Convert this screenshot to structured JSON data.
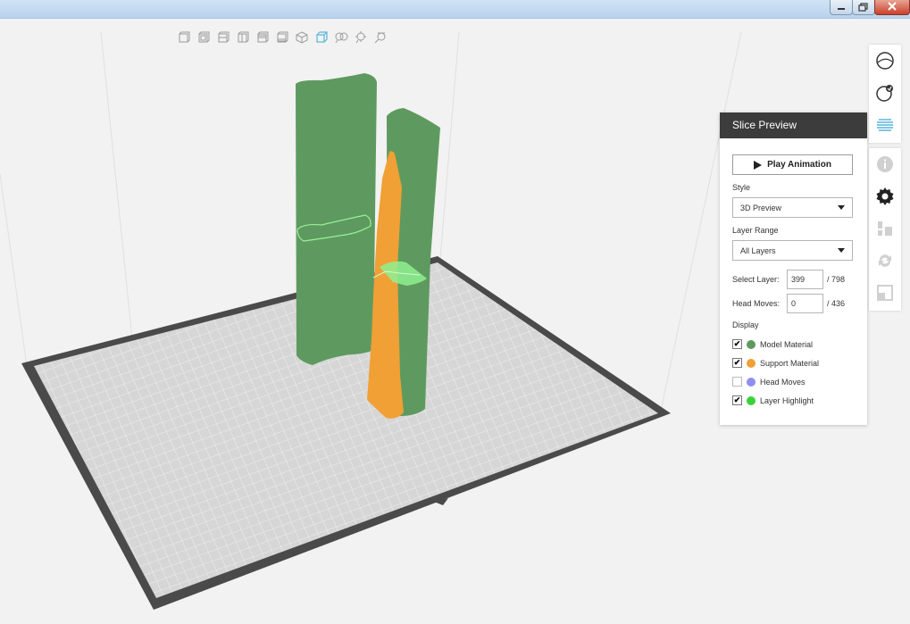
{
  "window": {
    "controls": [
      {
        "name": "minimize-button",
        "icon": "minimize-icon"
      },
      {
        "name": "restore-button",
        "icon": "restore-icon"
      },
      {
        "name": "close-button",
        "icon": "close-icon"
      }
    ]
  },
  "view_toolbar": {
    "icons": [
      "view-front-icon",
      "view-back-icon",
      "view-left-icon",
      "view-right-icon",
      "view-top-icon",
      "view-bottom-icon",
      "view-iso-icon",
      "view-perspective-icon",
      "zoom-icon",
      "zoom-fit-icon",
      "zoom-selection-icon"
    ],
    "active_index": 7
  },
  "right_toolbar": {
    "top_icons": [
      "print-prepare-icon",
      "print-preview-icon",
      "slice-preview-icon"
    ],
    "bottom_icons": [
      "info-icon",
      "settings-gear-icon",
      "align-icon",
      "rotate-icon",
      "scale-icon"
    ]
  },
  "slice_preview": {
    "title": "Slice Preview",
    "play_label": "Play Animation",
    "style_label": "Style",
    "style_value": "3D Preview",
    "layer_range_label": "Layer Range",
    "layer_range_value": "All Layers",
    "select_layer_label": "Select Layer:",
    "select_layer_value": "399",
    "select_layer_total": "/ 798",
    "head_moves_label": "Head Moves:",
    "head_moves_value": "0",
    "head_moves_total": "/ 436",
    "display_label": "Display",
    "display_items": [
      {
        "label": "Model Material",
        "checked": true,
        "mark": "✔",
        "color": "#5e9a5f"
      },
      {
        "label": "Support Material",
        "checked": true,
        "mark": "✔",
        "color": "#f0a035"
      },
      {
        "label": "Head Moves",
        "checked": false,
        "mark": "",
        "color": "#8f8ff0"
      },
      {
        "label": "Layer Highlight",
        "checked": true,
        "mark": "✔",
        "color": "#3ad13a"
      }
    ]
  },
  "colors": {
    "model": "#5e9a5f",
    "support": "#f0a035",
    "highlight": "#8ff08f",
    "bed": "#d6d6d6",
    "bed_border": "#4a4a4a",
    "accent": "#58b4d8"
  }
}
